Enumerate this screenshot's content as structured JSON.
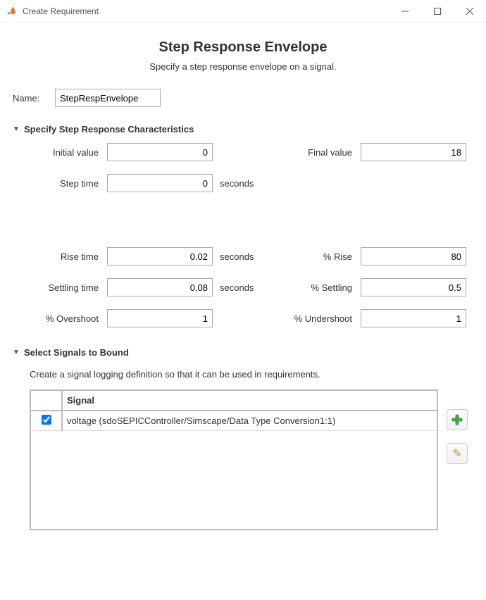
{
  "window": {
    "title": "Create Requirement"
  },
  "header": {
    "title": "Step Response Envelope",
    "subtitle": "Specify a step response envelope on a signal."
  },
  "name": {
    "label": "Name:",
    "value": "StepRespEnvelope"
  },
  "sections": {
    "chars": {
      "title": "Specify Step Response Characteristics",
      "labels": {
        "initial_value": "Initial value",
        "final_value": "Final value",
        "step_time": "Step time",
        "seconds": "seconds",
        "rise_time": "Rise time",
        "pct_rise": "% Rise",
        "settling_time": "Settling time",
        "pct_settling": "% Settling",
        "pct_overshoot": "% Overshoot",
        "pct_undershoot": "% Undershoot"
      },
      "values": {
        "initial_value": "0",
        "final_value": "18",
        "step_time": "0",
        "rise_time": "0.02",
        "pct_rise": "80",
        "settling_time": "0.08",
        "pct_settling": "0.5",
        "pct_overshoot": "1",
        "pct_undershoot": "1"
      }
    },
    "signals": {
      "title": "Select Signals to Bound",
      "hint": "Create a signal logging definition so that it can be used in requirements.",
      "columns": {
        "signal": "Signal"
      },
      "rows": [
        {
          "checked": true,
          "label": "voltage (sdoSEPICController/Simscape/Data Type Conversion1:1)"
        }
      ]
    }
  }
}
